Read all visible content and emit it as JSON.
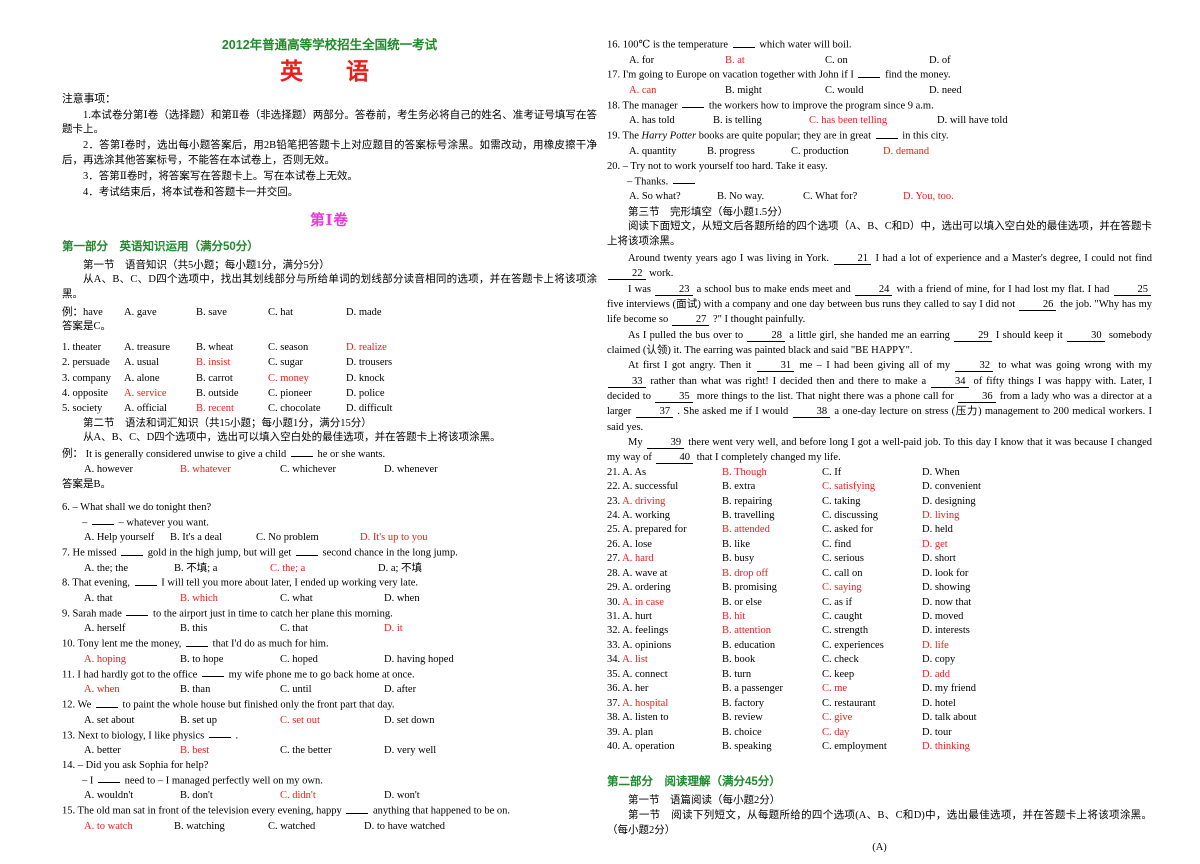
{
  "header": {
    "exam_title": "2012年普通高等学校招生全国统一考试",
    "subject": "英　语",
    "juan_title": "第Ⅰ卷",
    "title_color": "#1f8a2e",
    "subject_color": "#e8201a",
    "juan_color": "#e83ad8",
    "answer_color": "#ee1c19"
  },
  "notice": {
    "label": "注意事项：",
    "items": [
      "1.本试卷分第Ⅰ卷（选择题）和第Ⅱ卷（非选择题）两部分。答卷前，考生务必将自己的姓名、准考证号填写在答题卡上。",
      "2．答第Ⅰ卷时，选出每小题答案后，用2B铅笔把答题卡上对应题目的答案标号涂黑。如需改动，用橡皮擦干净后，再选涂其他答案标号，不能答在本试卷上，否则无效。",
      "3．答第Ⅱ卷时，将答案写在答题卡上。写在本试卷上无效。",
      "4．考试结束后，将本试卷和答题卡一并交回。"
    ]
  },
  "part1": {
    "heading": "第一部分　英语知识运用（满分50分）",
    "section1": {
      "heading": "第一节　语音知识（共5小题；每小题1分，满分5分）",
      "instruction": "从A、B、C、D四个选项中，找出其划线部分与所给单词的划线部分读音相同的选项，并在答题卡上将该项涂黑。",
      "example_label": "例：",
      "example_word": "have",
      "example_opts": [
        "A. gave",
        "B. save",
        "C. hat",
        "D. made"
      ],
      "example_answer": "答案是C。",
      "rows": [
        {
          "num": "1.",
          "word": "theater",
          "options": [
            "A. treasure",
            "B. wheat",
            "C. season",
            "D. realize"
          ],
          "correct": 3
        },
        {
          "num": "2.",
          "word": "persuade",
          "options": [
            "A. usual",
            "B. insist",
            "C. sugar",
            "D. trousers"
          ],
          "correct": 1
        },
        {
          "num": "3.",
          "word": "company",
          "options": [
            "A. alone",
            "B. carrot",
            "C. money",
            "D. knock"
          ],
          "correct": 2
        },
        {
          "num": "4.",
          "word": "opposite",
          "options": [
            "A. service",
            "B. outside",
            "C. pioneer",
            "D. police"
          ],
          "correct": 0
        },
        {
          "num": "5.",
          "word": "society",
          "options": [
            "A. official",
            "B. recent",
            "C. chocolate",
            "D. difficult"
          ],
          "correct": 1
        }
      ]
    },
    "section2": {
      "heading": "第二节　语法和词汇知识（共15小题；每小题1分，满分15分）",
      "instruction": "从A、B、C、D四个选项中，选出可以填入空白处的最佳选项，并在答题卡上将该项涂黑。",
      "example_label": "例：",
      "example_stem": "It is generally considered unwise to give a child ___ he or she wants.",
      "example_opts": [
        "A. however",
        "B. whatever",
        "C. whichever",
        "D. whenever"
      ],
      "example_correct": 1,
      "example_answer": "答案是B。",
      "questions": [
        {
          "num": "6.",
          "lines": [
            "– What shall we do tonight then?",
            "– ___ – whatever you want."
          ],
          "options": [
            "A. Help yourself",
            "B. It's a deal",
            "C. No problem",
            "D. It's up to you"
          ],
          "correct": 3
        },
        {
          "num": "7.",
          "lines": [
            "He missed ___ gold in the high jump, but will get ___ second chance in the long jump."
          ],
          "options": [
            "A. the; the",
            "B. 不填; a",
            "C. the; a",
            "D. a;  不填"
          ],
          "correct": 2
        },
        {
          "num": "8.",
          "lines": [
            "That evening, ___ I will tell you more about later, I ended up working very late."
          ],
          "options": [
            "A. that",
            "B. which",
            "C. what",
            "D. when"
          ],
          "correct": 1
        },
        {
          "num": "9.",
          "lines": [
            "Sarah made ___ to the airport just in time to catch her plane this morning."
          ],
          "options": [
            "A. herself",
            "B. this",
            "C. that",
            "D. it"
          ],
          "correct": 3
        },
        {
          "num": "10.",
          "lines": [
            "Tony lent me the money, ___ that I'd do as much for him."
          ],
          "options": [
            "A. hoping",
            "B. to hope",
            "C. hoped",
            "D. having hoped"
          ],
          "correct": 0
        },
        {
          "num": "11.",
          "lines": [
            "I had hardly got to the office ___ my wife phone me to go back home at once."
          ],
          "options": [
            "A. when",
            "B. than",
            "C. until",
            "D. after"
          ],
          "correct": 0
        },
        {
          "num": "12.",
          "lines": [
            "We ___ to paint the whole house but finished only the front part that day."
          ],
          "options": [
            "A. set about",
            "B. set up",
            "C. set out",
            "D. set down"
          ],
          "correct": 2
        },
        {
          "num": "13.",
          "lines": [
            "Next to biology, I like physics ___ ."
          ],
          "options": [
            "A. better",
            "B. best",
            "C. the better",
            "D. very well"
          ],
          "correct": 1
        },
        {
          "num": "14.",
          "lines": [
            "– Did you ask Sophia for help?",
            "– I ___ need to – I managed perfectly well on my own."
          ],
          "options": [
            "A. wouldn't",
            "B. don't",
            "C. didn't",
            "D. won't"
          ],
          "correct": 2
        },
        {
          "num": "15.",
          "lines": [
            "The old man sat in front of the television every evening, happy ___ anything that happened to be on."
          ],
          "options": [
            "A. to watch",
            "B. watching",
            "C. watched",
            "D. to have watched"
          ],
          "correct": 0
        },
        {
          "num": "16.",
          "lines": [
            "100℃  is the temperature ___ which water will boil."
          ],
          "options": [
            "A. for",
            "B. at",
            "C. on",
            "D. of"
          ],
          "correct": 1
        },
        {
          "num": "17.",
          "lines": [
            "I'm going to Europe on vacation together with John if I ___ find the money."
          ],
          "options": [
            "A. can",
            "B. might",
            "C. would",
            "D. need"
          ],
          "correct": 0
        },
        {
          "num": "18.",
          "lines": [
            "The manager ___ the workers how to improve the program since 9 a.m."
          ],
          "options": [
            "A. has told",
            "B. is telling",
            "C. has been telling",
            "D. will have told"
          ],
          "correct": 2
        },
        {
          "num": "19.",
          "lines": [
            "The Harry Potter books are quite popular; they are in great ___ in this city."
          ],
          "italic_span": "Harry Potter",
          "options": [
            "A. quantity",
            "B. progress",
            "C. production",
            "D. demand"
          ],
          "correct": 3
        },
        {
          "num": "20.",
          "lines": [
            "– Try not to work yourself too hard. Take it easy.",
            "– Thanks. ___"
          ],
          "options": [
            "A. So what?",
            "B. No way.",
            "C. What for?",
            "D. You, too."
          ],
          "correct": 3
        }
      ]
    },
    "section3": {
      "heading": "第三节　完形填空（每小题1.5分）",
      "instruction": "阅读下面短文，从短文后各题所给的四个选项（A、B、C和D）中，选出可以填入空白处的最佳选项，并在答题卡上将该项涂黑。",
      "passage": [
        "Around twenty years ago I was living in York.  _21_  I had a lot of experience and a Master's degree, I could not find _22_  work.",
        "I was  _23_  a school bus to make ends meet and  _24_  with a friend of mine, for I had lost my flat. I had  _25_  five interviews (面试) with a company and one day between bus runs they called to say I did not  _26_  the job. \"Why has my life become so  _27_ ?\" I thought painfully.",
        "As I pulled the bus over to  _28_  a little girl, she handed me an earring  _29_  I should keep it  _30_  somebody claimed (认领) it. The earring was painted black and said \"BE HAPPY\".",
        "At first I got angry. Then it  _31_  me – I had been giving all of my  _32_  to what was going wrong with my  _33_  rather than what was right! I decided then and there to make a  _34_  of fifty things I was happy with. Later, I decided to _35_  more things to the list. That night there was a phone call for  _36_  from a lady who was a director at a larger  _37_ . She asked me if I would  _38_  a one-day lecture on stress (压力) management to 200 medical workers. I said yes.",
        "My  _39_  there went very well, and before long I got a well-paid job. To this day I know that it was because I changed my way of  _40_  that I completely changed my life."
      ],
      "cloze_options": [
        {
          "num": "21.",
          "options": [
            "A. As",
            "B. Though",
            "C. If",
            "D. When"
          ],
          "correct": 1
        },
        {
          "num": "22.",
          "options": [
            "A. successful",
            "B. extra",
            "C. satisfying",
            "D. convenient"
          ],
          "correct": 2
        },
        {
          "num": "23.",
          "options": [
            "A. driving",
            "B. repairing",
            "C. taking",
            "D. designing"
          ],
          "correct": 0
        },
        {
          "num": "24.",
          "options": [
            "A. working",
            "B. travelling",
            "C. discussing",
            "D. living"
          ],
          "correct": 3
        },
        {
          "num": "25.",
          "options": [
            "A. prepared for",
            "B. attended",
            "C. asked for",
            "D. held"
          ],
          "correct": 1
        },
        {
          "num": "26.",
          "options": [
            "A. lose",
            "B. like",
            "C. find",
            "D. get"
          ],
          "correct": 3
        },
        {
          "num": "27.",
          "options": [
            "A. hard",
            "B. busy",
            "C. serious",
            "D. short"
          ],
          "correct": 0
        },
        {
          "num": "28.",
          "options": [
            "A. wave at",
            "B. drop off",
            "C. call on",
            "D. look for"
          ],
          "correct": 1
        },
        {
          "num": "29.",
          "options": [
            "A. ordering",
            "B. promising",
            "C. saying",
            "D. showing"
          ],
          "correct": 2
        },
        {
          "num": "30.",
          "options": [
            "A. in case",
            "B. or else",
            "C. as if",
            "D. now that"
          ],
          "correct": 0
        },
        {
          "num": "31.",
          "options": [
            "A. hurt",
            "B. hit",
            "C. caught",
            "D. moved"
          ],
          "correct": 1
        },
        {
          "num": "32.",
          "options": [
            "A. feelings",
            "B. attention",
            "C. strength",
            "D. interests"
          ],
          "correct": 1
        },
        {
          "num": "33.",
          "options": [
            "A. opinions",
            "B. education",
            "C. experiences",
            "D. life"
          ],
          "correct": 3
        },
        {
          "num": "34.",
          "options": [
            "A. list",
            "B. book",
            "C. check",
            "D. copy"
          ],
          "correct": 0
        },
        {
          "num": "35.",
          "options": [
            "A. connect",
            "B. turn",
            "C. keep",
            "D. add"
          ],
          "correct": 3
        },
        {
          "num": "36.",
          "options": [
            "A. her",
            "B. a passenger",
            "C. me",
            "D. my friend"
          ],
          "correct": 2
        },
        {
          "num": "37.",
          "options": [
            "A. hospital",
            "B. factory",
            "C. restaurant",
            "D. hotel"
          ],
          "correct": 0
        },
        {
          "num": "38.",
          "options": [
            "A. listen to",
            "B. review",
            "C. give",
            "D. talk about"
          ],
          "correct": 2
        },
        {
          "num": "39.",
          "options": [
            "A. plan",
            "B. choice",
            "C. day",
            "D. tour"
          ],
          "correct": 2
        },
        {
          "num": "40.",
          "options": [
            "A. operation",
            "B. speaking",
            "C. employment",
            "D. thinking"
          ],
          "correct": 3
        }
      ]
    }
  },
  "part2": {
    "heading": "第二部分　阅读理解（满分45分）",
    "section1_heading": "第一节　语篇阅读（每小题2分）",
    "section1_instruction": "第一节　阅读下列短文，从每题所给的四个选项(A、B、C和D)中，选出最佳选项，并在答题卡上将该项涂黑。（每小题2分）",
    "passage_label": "(A)"
  }
}
